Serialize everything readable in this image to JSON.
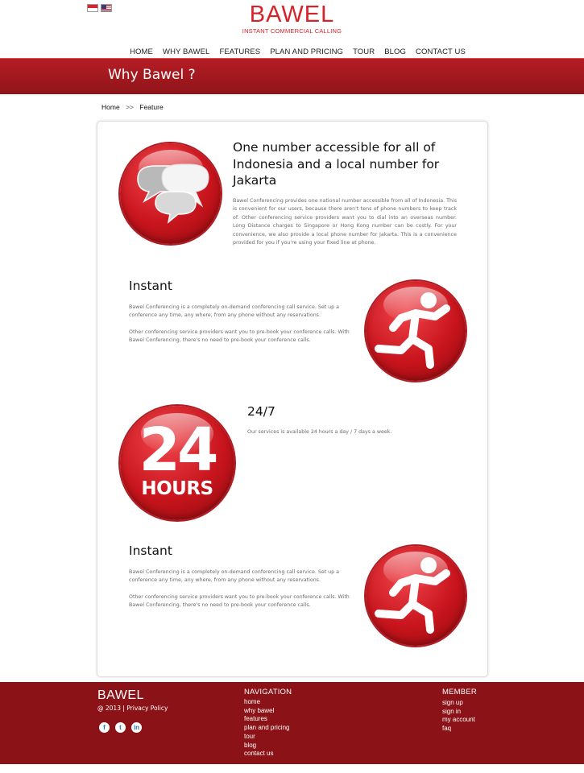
{
  "header": {
    "brand": "BAWEL",
    "tagline": "INSTANT COMMERCIAL CALLING",
    "languages": [
      "Indonesian flag",
      "English flag"
    ]
  },
  "nav": [
    "HOME",
    "WHY BAWEL",
    "FEATURES",
    "PLAN AND PRICING",
    "TOUR",
    "BLOG",
    "CONTACT US"
  ],
  "banner": {
    "title": "Why Bawel ?"
  },
  "breadcrumb": {
    "home": "Home",
    "separator": ">>",
    "current": "Feature"
  },
  "features": [
    {
      "icon": "chat-bubbles-icon",
      "title": "One number accessible for all of Indonesia and a local number for Jakarta",
      "paragraphs": [
        "Bawel Conferencing provides one national number accessible from all of Indonesia. This is convenient for our users, because there aren't tens of phone numbers to keep track of. Other conferencing service providers want you to dial into an overseas number. Long Distance charges to Singapore or Hong Kong number can be costly. For your convenience, we also provide a local phone number for Jakarta. This is a convenience provided for you if you're using your fixed line at phone."
      ]
    },
    {
      "icon": "running-man-icon",
      "title": "Instant",
      "paragraphs": [
        "Bawel Conferencing is a completely on-demand conferencing call service. Set up a conference any time, any where, from any phone without any reservations.",
        "Other conferencing service providers want you to pre-book your conference calls. With Bawel Conferencing, there's no need to pre-book your conference calls."
      ]
    },
    {
      "icon": "24-hours-icon",
      "icon_text": {
        "number": "24",
        "label": "HOURS"
      },
      "title": "24/7",
      "paragraphs": [
        "Our services is available 24 hours a day / 7 days a week."
      ]
    },
    {
      "icon": "running-man-icon",
      "title": "Instant",
      "paragraphs": [
        "Bawel Conferencing is a completely on-demand conferencing call service. Set up a conference any time, any where, from any phone without any reservations.",
        "Other conferencing service providers want you to pre-book your conference calls. With Bawel Conferencing, there's no need to pre-book your conference calls."
      ]
    }
  ],
  "footer": {
    "brand": "BAWEL",
    "copyright": "@ 2013 | Privacy Policy",
    "social": [
      "f",
      "t",
      "in"
    ],
    "navigation": {
      "title": "NAVIGATION",
      "links": [
        "home",
        "why bawel",
        "features",
        "plan and pricing",
        "tour",
        "blog",
        "contact us"
      ]
    },
    "member": {
      "title": "MEMBER",
      "links": [
        "sign up",
        "sign in",
        "my account",
        "faq"
      ]
    }
  },
  "colors": {
    "brand_red": "#d6232a",
    "banner_red": "#a8191f",
    "footer_red": "#8b1217"
  }
}
